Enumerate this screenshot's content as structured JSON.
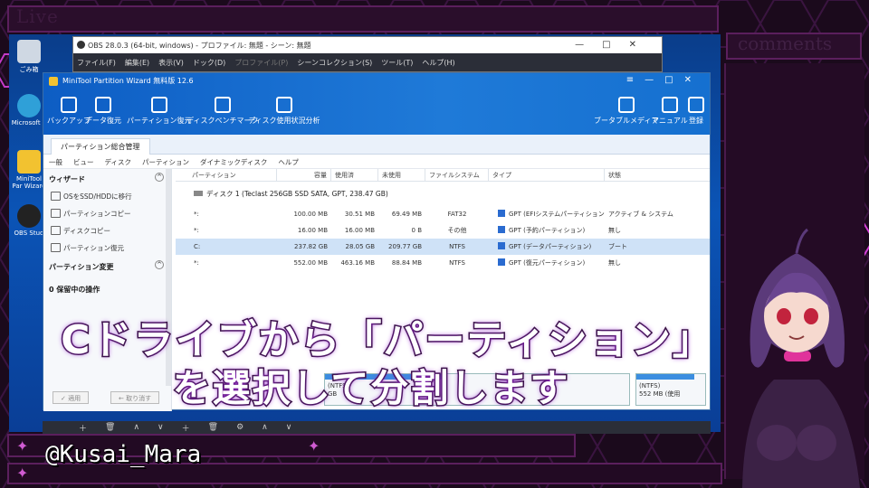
{
  "overlay": {
    "live_title": "Live",
    "comments_title": "comments",
    "handle": "@Kusai_Mara"
  },
  "desktop_icons": [
    "ごみ箱",
    "Microsoft E",
    "MiniTool Par Wizard",
    "OBS Stud"
  ],
  "obs": {
    "title": "OBS 28.0.3 (64-bit, windows) - プロファイル: 無題 - シーン: 無題",
    "menu": [
      "ファイル(F)",
      "編集(E)",
      "表示(V)",
      "ドック(D)",
      "プロファイル(P)",
      "シーンコレクション(S)",
      "ツール(T)",
      "ヘルプ(H)"
    ]
  },
  "minitool": {
    "title": "MiniTool Partition Wizard 無料版 12.6",
    "toolbar": [
      "バックアップ",
      "データ復元",
      "パーティション復元",
      "ディスクベンチマーク",
      "ディスク使用状況分析"
    ],
    "toolbar_right": [
      "ブータブルメディア",
      "マニュアル",
      "登録"
    ],
    "tab": "パーティション総合管理",
    "menu": [
      "一般",
      "ビュー",
      "ディスク",
      "パーティション",
      "ダイナミックディスク",
      "ヘルプ"
    ],
    "sidebar": {
      "wizard_title": "ウィザード",
      "wizard_items": [
        "OSをSSD/HDDに移行",
        "パーティションコピー",
        "ディスクコピー",
        "パーティション復元"
      ],
      "change_title": "パーティション変更",
      "pending": "0 保留中の操作",
      "apply": "✓ 適用",
      "undo": "← 取り消す"
    },
    "columns": [
      "パーティション",
      "容量",
      "使用済",
      "未使用",
      "ファイルシステム",
      "タイプ",
      "状態"
    ],
    "disk_label": "ディスク 1 (Teclast 256GB SSD SATA, GPT, 238.47 GB)",
    "partitions": [
      {
        "name": "*:",
        "capacity": "100.00 MB",
        "used": "30.51 MB",
        "free": "69.49 MB",
        "fs": "FAT32",
        "type": "GPT (EFIシステムパーティション)",
        "status": "アクティブ & システム"
      },
      {
        "name": "*:",
        "capacity": "16.00 MB",
        "used": "16.00 MB",
        "free": "0 B",
        "fs": "その他",
        "type": "GPT (予約パーティション)",
        "status": "無し"
      },
      {
        "name": "C:",
        "capacity": "237.82 GB",
        "used": "28.05 GB",
        "free": "209.77 GB",
        "fs": "NTFS",
        "type": "GPT (データパーティション)",
        "status": "ブート"
      },
      {
        "name": "*:",
        "capacity": "552.00 MB",
        "used": "463.16 MB",
        "free": "88.84 MB",
        "fs": "NTFS",
        "type": "GPT (復元パーティション)",
        "status": "無し"
      }
    ],
    "diskmap": {
      "c_text": "(NTFS)",
      "c_size": "GB",
      "r_text": "(NTFS)",
      "r_size": "552 MB (使用"
    }
  },
  "caption": {
    "line1": "Cドライブから「パーティション」",
    "line2": "を選択して分割します"
  }
}
